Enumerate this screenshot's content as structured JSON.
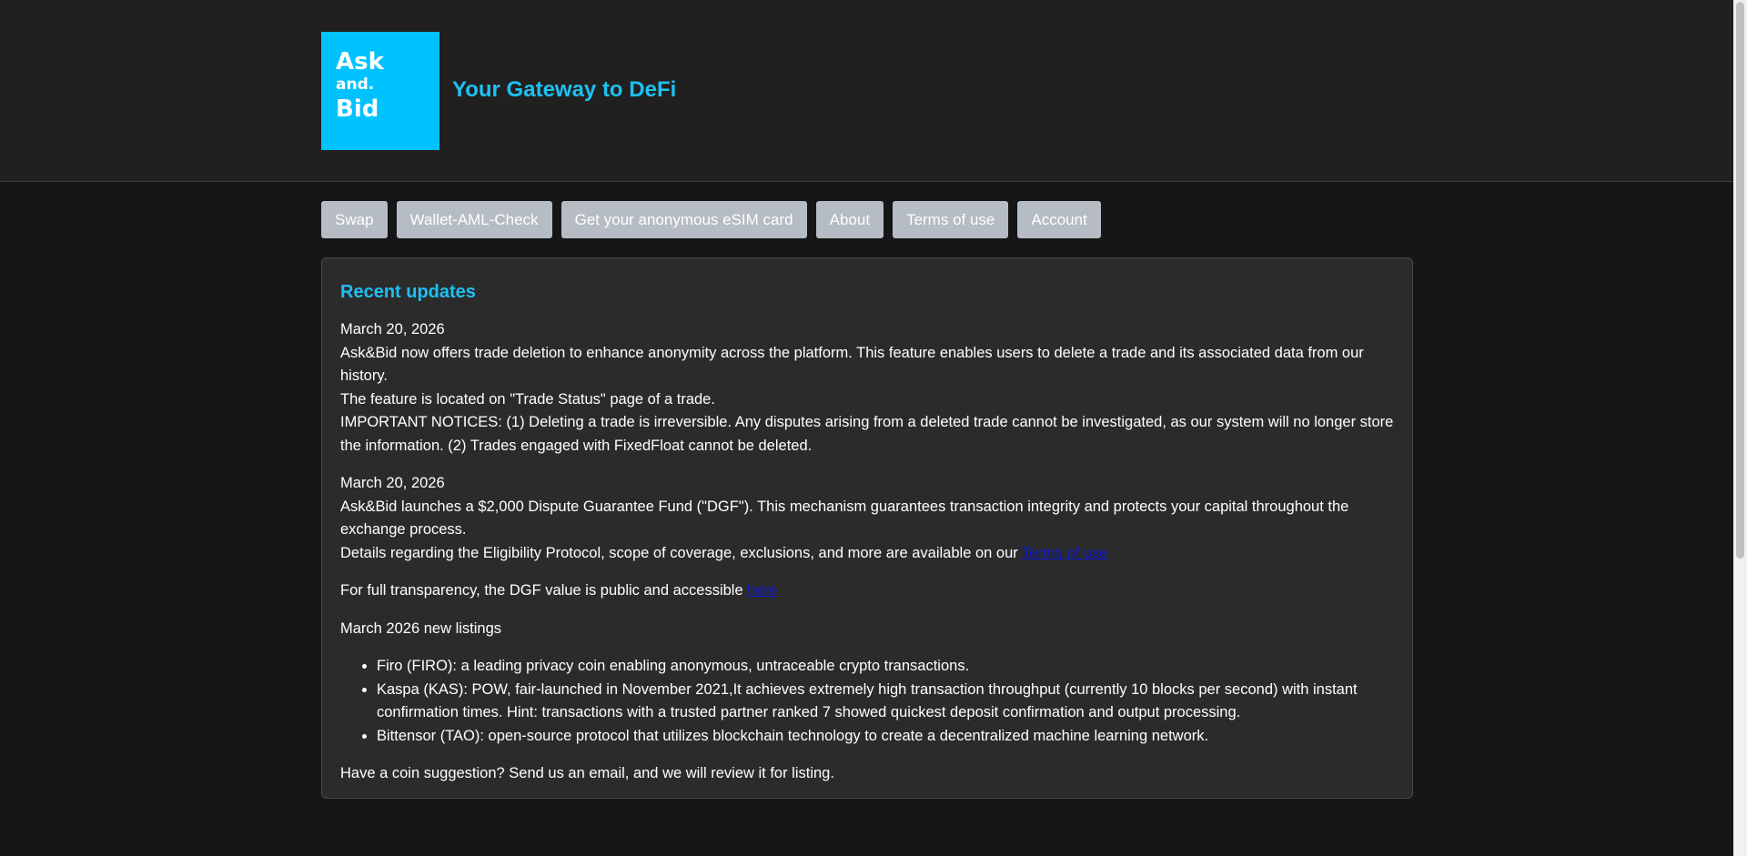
{
  "header": {
    "logo": {
      "line1": "Ask",
      "line2": "and.",
      "line3": "Bid"
    },
    "tagline": "Your Gateway to DeFi"
  },
  "nav": {
    "items": [
      {
        "label": "Swap"
      },
      {
        "label": "Wallet-AML-Check"
      },
      {
        "label": "Get your anonymous eSIM card"
      },
      {
        "label": "About"
      },
      {
        "label": "Terms of use"
      },
      {
        "label": "Account"
      }
    ]
  },
  "updates": {
    "title": "Recent updates",
    "entries": [
      {
        "date": "March 20, 2026",
        "text": "Ask&Bid now offers trade deletion to enhance anonymity across the platform. This feature enables users to delete a trade and its associated data from our history.",
        "location": "The feature is located on \"Trade Status\" page of a trade.",
        "notice": "IMPORTANT NOTICES: (1) Deleting a trade is irreversible. Any disputes arising from a deleted trade cannot be investigated, as our system will no longer store the information. (2) Trades engaged with FixedFloat cannot be deleted."
      },
      {
        "date": "March 20, 2026",
        "text": "Ask&Bid launches a $2,000 Dispute Guarantee Fund (\"DGF\"). This mechanism guarantees transaction integrity and protects your capital throughout the exchange process.",
        "details": "Details regarding the Eligibility Protocol, scope of coverage, exclusions, and more are available on our ",
        "details_link": "Terms of use"
      }
    ],
    "transparency": {
      "text": "For full transparency, the DGF value is public and accessible ",
      "link": "here"
    },
    "listings": {
      "heading": "March 2026 new listings",
      "items": [
        "Firo (FIRO): a leading privacy coin enabling anonymous, untraceable crypto transactions.",
        "Kaspa (KAS): POW, fair-launched in November 2021,It achieves extremely high transaction throughput (currently 10 blocks per second) with instant confirmation times. Hint: transactions with a trusted partner ranked 7 showed quickest deposit confirmation and output processing.",
        "Bittensor (TAO): open-source protocol that utilizes blockchain technology to create a decentralized machine learning network."
      ]
    },
    "suggestion": "Have a coin suggestion? Send us an email, and we will review it for listing."
  },
  "colors": {
    "accent": "#1ec0f2",
    "logo_bg": "#00c2ff",
    "nav_button_bg": "#b6bcc3",
    "link": "#0a14d6"
  }
}
